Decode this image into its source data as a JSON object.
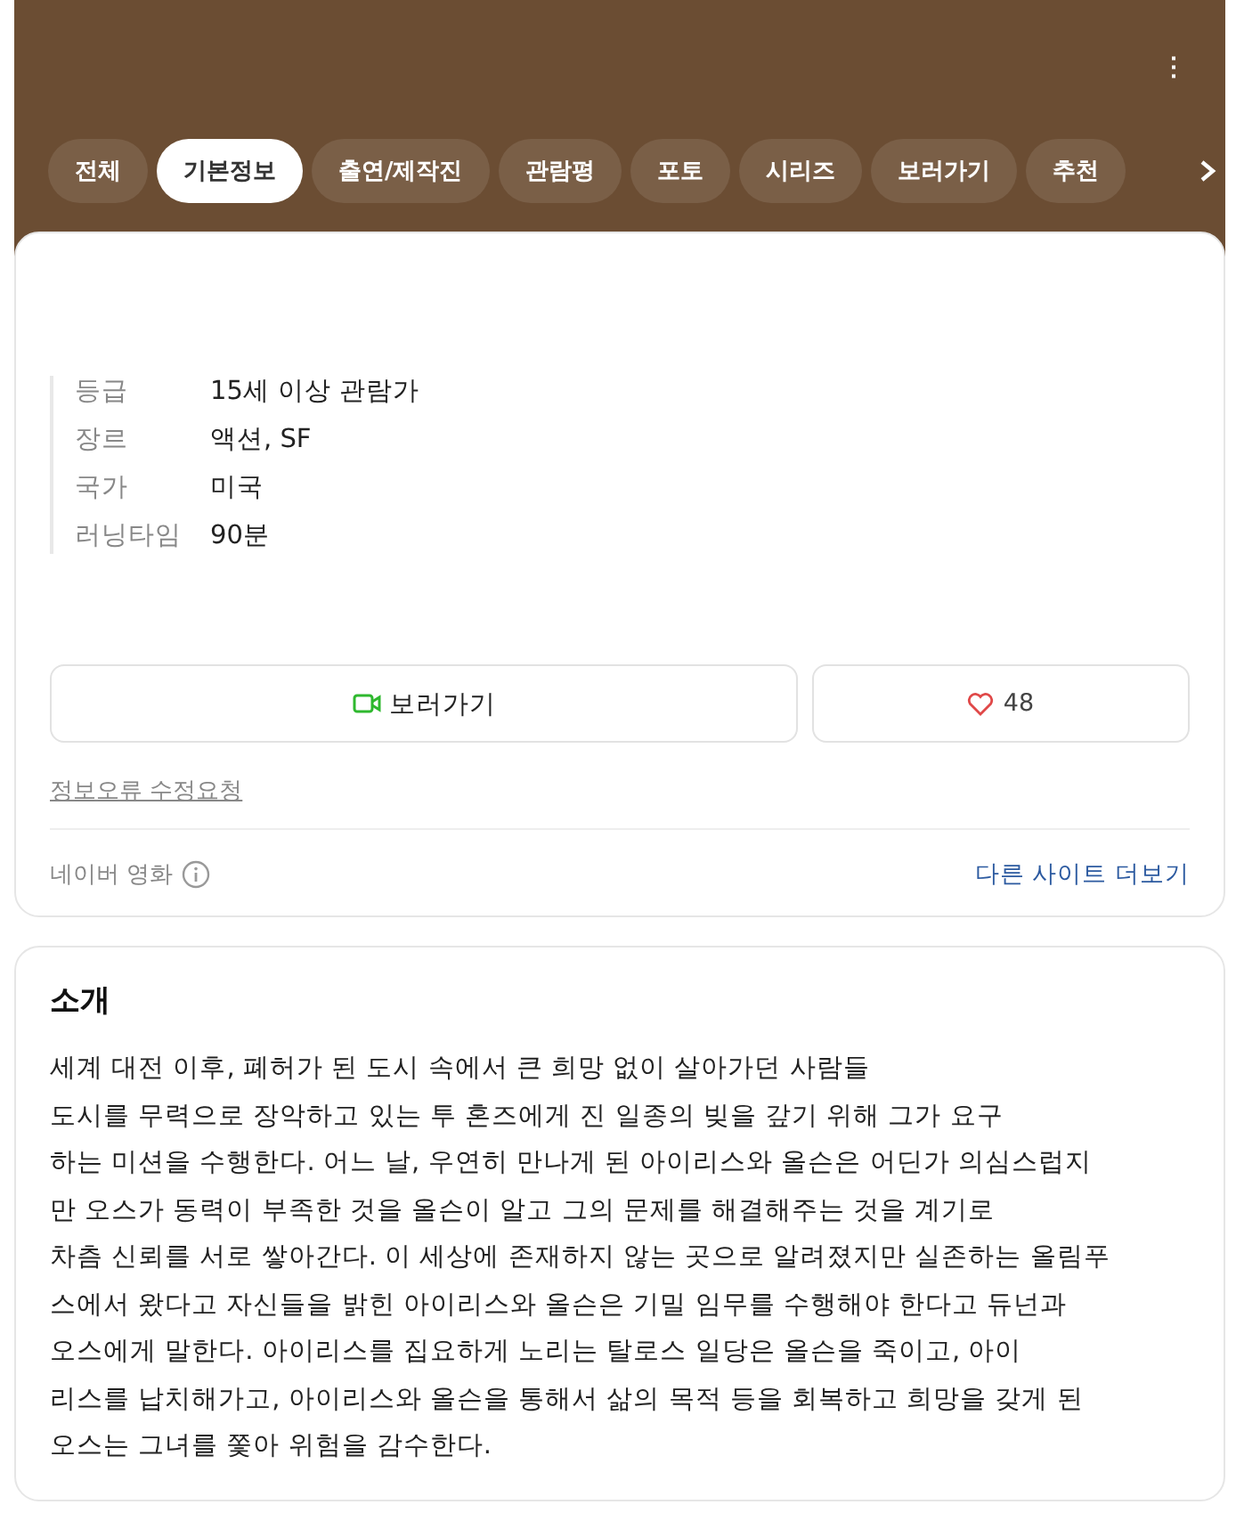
{
  "header": {
    "menu": "⋮"
  },
  "tabs": [
    {
      "label": "전체",
      "selected": false
    },
    {
      "label": "기본정보",
      "selected": true
    },
    {
      "label": "출연/제작진",
      "selected": false
    },
    {
      "label": "관람평",
      "selected": false
    },
    {
      "label": "포토",
      "selected": false
    },
    {
      "label": "시리즈",
      "selected": false
    },
    {
      "label": "보러가기",
      "selected": false
    },
    {
      "label": "추천",
      "selected": false
    }
  ],
  "info": [
    {
      "label": "등급",
      "value": "15세 이상 관람가"
    },
    {
      "label": "장르",
      "value": "액션, SF"
    },
    {
      "label": "국가",
      "value": "미국"
    },
    {
      "label": "러닝타임",
      "value": "90분"
    }
  ],
  "watch_button": {
    "label": "보러가기"
  },
  "like_button": {
    "count": "48"
  },
  "report_link": "정보오류 수정요청",
  "footer": {
    "source": "네이버 영화",
    "more_link": "다른 사이트 더보기"
  },
  "intro": {
    "title": "소개",
    "text": "세계 대전 이후, 폐허가 된 도시 속에서 큰 희망 없이 살아가던 사람들\n도시를 무력으로 장악하고 있는 투 혼즈에게 진 일종의 빚을 갚기 위해 그가 요구\n하는 미션을 수행한다. 어느 날, 우연히 만나게 된 아이리스와 올슨은 어딘가 의심스럽지\n만 오스가 동력이 부족한 것을 올슨이 알고 그의 문제를 해결해주는 것을 계기로\n차츰 신뢰를 서로 쌓아간다. 이 세상에 존재하지 않는 곳으로 알려졌지만 실존하는 올림푸\n스에서 왔다고 자신들을 밝힌 아이리스와 올슨은 기밀 임무를 수행해야 한다고 듀넌과\n오스에게 말한다. 아이리스를 집요하게 노리는 탈로스 일당은 올슨을 죽이고, 아이\n리스를 납치해가고, 아이리스와 올슨을 통해서 삶의 목적 등을 회복하고 희망을 갖게 된\n오스는 그녀를 쫓아 위험을 감수한다."
  }
}
